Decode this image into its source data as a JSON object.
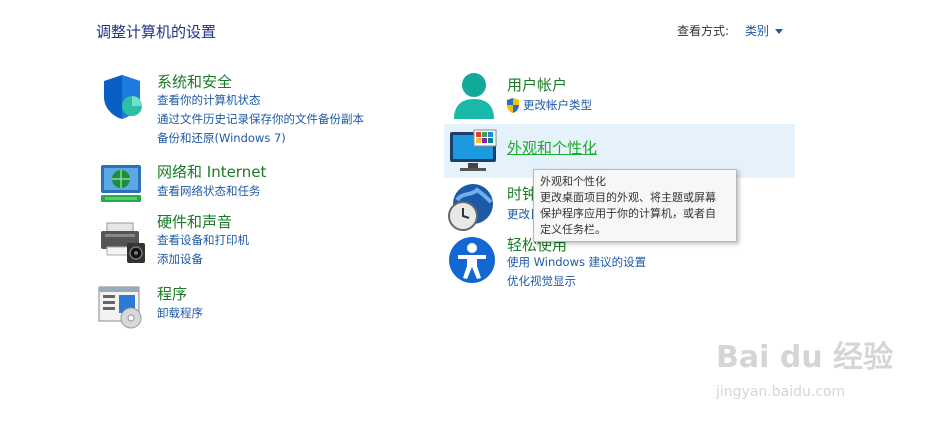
{
  "header": {
    "title": "调整计算机的设置",
    "view_by_label": "查看方式:",
    "view_by_value": "类别"
  },
  "categories": {
    "system_security": {
      "title": "系统和安全",
      "links": [
        "查看你的计算机状态",
        "通过文件历史记录保存你的文件备份副本",
        "备份和还原(Windows 7)"
      ]
    },
    "network": {
      "title": "网络和 Internet",
      "links": [
        "查看网络状态和任务"
      ]
    },
    "hardware": {
      "title": "硬件和声音",
      "links": [
        "查看设备和打印机",
        "添加设备"
      ]
    },
    "programs": {
      "title": "程序",
      "links": [
        "卸载程序"
      ]
    },
    "user_accounts": {
      "title": "用户帐户",
      "links": [
        "更改帐户类型"
      ]
    },
    "appearance": {
      "title": "外观和个性化"
    },
    "clock_region": {
      "title": "时钟和区域",
      "links": [
        "更改日期、时间或数字格式"
      ]
    },
    "ease_of_access": {
      "title": "轻松使用",
      "links": [
        "使用 Windows 建议的设置",
        "优化视觉显示"
      ]
    }
  },
  "tooltip": {
    "title": "外观和个性化",
    "lines": [
      "更改桌面项目的外观、将主题或屏幕",
      "保护程序应用于你的计算机，或者自",
      "定义任务栏。"
    ]
  },
  "watermark": {
    "brand": "Bai du 经验",
    "url": "jingyan.baidu.com"
  },
  "colors": {
    "category_green": "#1a7a25",
    "link_blue": "#1e5aa8",
    "title_navy": "#1e3287",
    "hover_bg": "#e5f1fb"
  }
}
